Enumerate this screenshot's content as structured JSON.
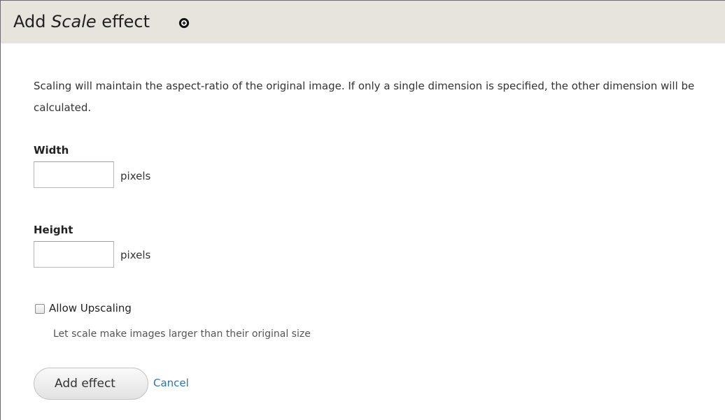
{
  "header": {
    "title_prefix": "Add ",
    "title_emphasis": "Scale",
    "title_suffix": " effect",
    "icon": "plus-circle-icon",
    "background": "#e6e4dc"
  },
  "form": {
    "description": "Scaling will maintain the aspect-ratio of the original image. If only a single dimension is specified, the other dimension will be calculated.",
    "width": {
      "label": "Width",
      "value": "",
      "suffix": "pixels"
    },
    "height": {
      "label": "Height",
      "value": "",
      "suffix": "pixels"
    },
    "upscale": {
      "label": "Allow Upscaling",
      "checked": false,
      "help": "Let scale make images larger than their original size"
    }
  },
  "actions": {
    "submit_label": "Add effect",
    "cancel_label": "Cancel",
    "link_color": "#2b74b8"
  }
}
